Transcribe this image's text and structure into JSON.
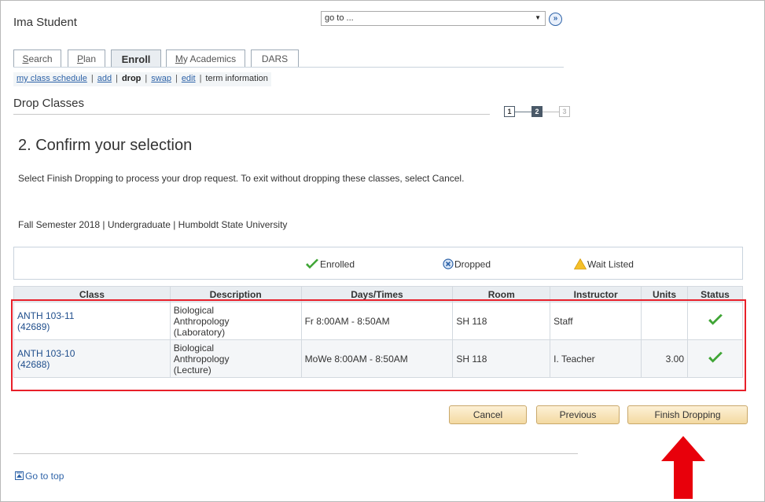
{
  "header": {
    "student_name": "Ima Student",
    "goto_value": "go to ...",
    "goto_go_glyph": "»"
  },
  "tabs": [
    {
      "label": "Search",
      "underline": "S",
      "rest": "earch"
    },
    {
      "label": "Plan",
      "underline": "P",
      "rest": "lan"
    },
    {
      "label": "Enroll"
    },
    {
      "label": "My Academics",
      "underline": "M",
      "rest": "y Academics"
    },
    {
      "label": "DARS"
    }
  ],
  "subnav": {
    "items": [
      "my class schedule",
      "add",
      "drop",
      "swap",
      "edit",
      "term information"
    ],
    "separator": "|"
  },
  "section": {
    "title": "Drop Classes",
    "steps": [
      "1",
      "2",
      "3"
    ]
  },
  "page": {
    "heading": "2.  Confirm your selection",
    "instructions": "Select Finish Dropping to process your drop request. To exit without dropping these classes, select Cancel.",
    "term": "Fall Semester 2018 | Undergraduate | Humboldt State University"
  },
  "legend": {
    "enrolled": "Enrolled",
    "dropped": "Dropped",
    "waitlisted": "Wait Listed"
  },
  "table": {
    "headers": [
      "Class",
      "Description",
      "Days/Times",
      "Room",
      "Instructor",
      "Units",
      "Status"
    ],
    "rows": [
      {
        "class_line1": "ANTH 103-11",
        "class_line2": "(42689)",
        "desc_line1": "Biological",
        "desc_line2": "Anthropology",
        "desc_line3": "(Laboratory)",
        "days_times": "Fr 8:00AM - 8:50AM",
        "room": "SH 118",
        "instructor": "Staff",
        "units": "",
        "status": "enrolled"
      },
      {
        "class_line1": "ANTH 103-10",
        "class_line2": "(42688)",
        "desc_line1": "Biological",
        "desc_line2": "Anthropology",
        "desc_line3": "(Lecture)",
        "days_times": "MoWe 8:00AM - 8:50AM",
        "room": "SH 118",
        "instructor": "I. Teacher",
        "units": "3.00",
        "status": "enrolled"
      }
    ]
  },
  "buttons": {
    "cancel": "Cancel",
    "previous": "Previous",
    "finish": "Finish Dropping"
  },
  "footer": {
    "goto_top": "Go to top"
  },
  "colors": {
    "link": "#2e63a8",
    "highlight": "#e8202a",
    "check": "#3fa535",
    "button_bg": "#f3d9a1"
  }
}
